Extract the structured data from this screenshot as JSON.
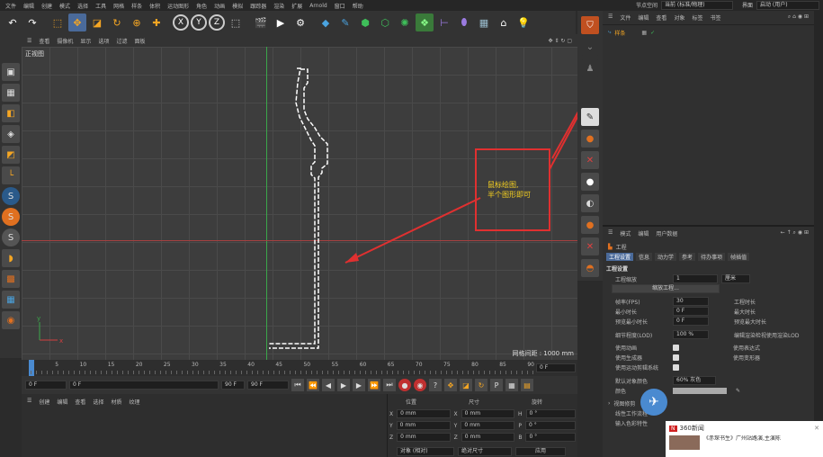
{
  "menu": {
    "items": [
      "文件",
      "编辑",
      "创建",
      "模式",
      "选择",
      "工具",
      "网格",
      "样条",
      "体积",
      "运动图形",
      "角色",
      "动画",
      "模拟",
      "跟踪器",
      "渲染",
      "扩展",
      "Arnold",
      "窗口",
      "帮助"
    ],
    "layout_label": "节点空间",
    "layout_value": "当前 (标准/物理)",
    "interface_label": "界面",
    "interface_value": "启动 (用户)"
  },
  "viewport": {
    "menu": [
      "查看",
      "摄像机",
      "显示",
      "选项",
      "过滤",
      "面板"
    ],
    "name": "正视图",
    "grid_info": "网格间距 : 1000 mm"
  },
  "annotation": {
    "line1": "鼠标绘图,",
    "line2": "半个图形即可"
  },
  "timeline": {
    "ticks": [
      "0",
      "5",
      "10",
      "15",
      "20",
      "25",
      "30",
      "35",
      "40",
      "45",
      "50",
      "55",
      "60",
      "65",
      "70",
      "75",
      "80",
      "85",
      "90"
    ],
    "current_frame": "0 F"
  },
  "playbar": {
    "start": "0 F",
    "start2": "0 F",
    "end": "90 F",
    "end2": "90 F"
  },
  "matpanel": {
    "menu": [
      "创建",
      "编辑",
      "查看",
      "选择",
      "材质",
      "纹理"
    ]
  },
  "coords": {
    "headers": [
      "位置",
      "尺寸",
      "旋转"
    ],
    "rows": [
      {
        "axis": "X",
        "pos": "0 mm",
        "size": "0 mm",
        "rot_label": "H",
        "rot": "0 °"
      },
      {
        "axis": "Y",
        "pos": "0 mm",
        "size": "0 mm",
        "rot_label": "P",
        "rot": "0 °"
      },
      {
        "axis": "Z",
        "pos": "0 mm",
        "size": "0 mm",
        "rot_label": "B",
        "rot": "0 °"
      }
    ],
    "mode1": "对象 (相对)",
    "mode2": "绝对尺寸",
    "apply": "应用"
  },
  "objects": {
    "menu": [
      "文件",
      "编辑",
      "查看",
      "对象",
      "标签",
      "书签"
    ],
    "item": "样条"
  },
  "attributes": {
    "menu": [
      "模式",
      "编辑",
      "用户数据"
    ],
    "title": "工程",
    "tabs": [
      "工程设置",
      "信息",
      "动力学",
      "参考",
      "待办事项",
      "帧插值"
    ],
    "section": "工程设置",
    "scale_label": "工程缩放",
    "scale_value": "1",
    "scale_unit": "厘米",
    "scale_button": "缩放工程...",
    "fps_label": "帧率(FPS)",
    "fps_value": "30",
    "min_label": "最小时长",
    "min_value": "0 F",
    "preview_min_label": "预览最小时长",
    "preview_min_value": "0 F",
    "proj_time": "工程时长",
    "max_time": "最大时长",
    "preview_max": "预览最大时长",
    "lod_label": "细节程度(LOD)",
    "lod_value": "100 %",
    "lod_right": "编辑渲染检视使用渲染LOD",
    "use_anim": "使用动画",
    "use_expr": "使用表达式",
    "use_gen": "使用生成器",
    "use_deform": "使用变形器",
    "use_motion": "使用运动剪辑系统",
    "default_color_label": "默认对象颜色",
    "default_color_value": "60% 灰色",
    "color_label": "颜色",
    "view_clip": "视图修剪",
    "linear_workflow": "线性工作流程",
    "input_color": "输入色彩特性"
  },
  "news": {
    "title": "360新闻",
    "text": "《赤琛书生》广州站路演,主演陈"
  }
}
